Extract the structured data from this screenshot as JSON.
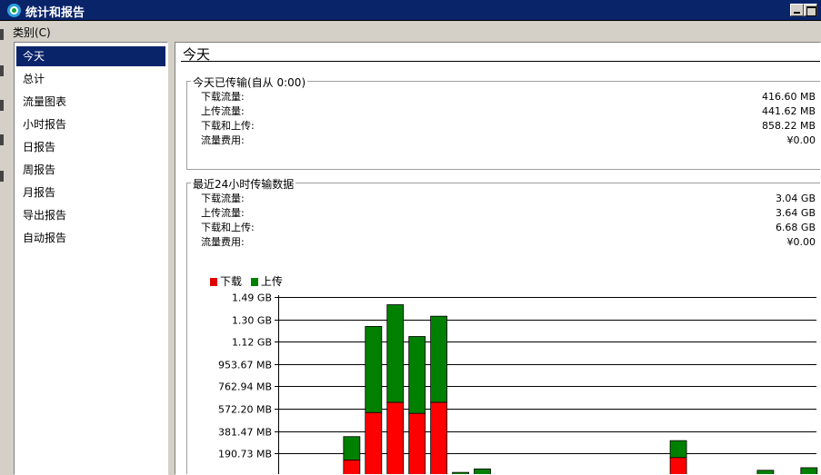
{
  "window": {
    "title": "统计和报告"
  },
  "menu": {
    "category_label": "类别(C)"
  },
  "sidebar": {
    "items": [
      {
        "label": "今天"
      },
      {
        "label": "总计"
      },
      {
        "label": "流量图表"
      },
      {
        "label": "小时报告"
      },
      {
        "label": "日报告"
      },
      {
        "label": "周报告"
      },
      {
        "label": "月报告"
      },
      {
        "label": "导出报告"
      },
      {
        "label": "自动报告"
      }
    ],
    "selected_index": 0
  },
  "main": {
    "title": "今天",
    "today_group": {
      "legend": "今天已传输(自从 0:00)",
      "rows": [
        {
          "label": "下载流量:",
          "value": "416.60 MB"
        },
        {
          "label": "上传流量:",
          "value": "441.62 MB"
        },
        {
          "label": "下载和上传:",
          "value": "858.22 MB"
        },
        {
          "label": "流量费用:",
          "value": "¥0.00"
        }
      ]
    },
    "last24_group": {
      "legend": "最近24小时传输数据",
      "rows": [
        {
          "label": "下载流量:",
          "value": "3.04 GB"
        },
        {
          "label": "上传流量:",
          "value": "3.64 GB"
        },
        {
          "label": "下载和上传:",
          "value": "6.68 GB"
        },
        {
          "label": "流量费用:",
          "value": "¥0.00"
        }
      ]
    }
  },
  "chart_data": {
    "type": "bar",
    "stacked": true,
    "y_unit": "MB",
    "ylim_visible": [
      0,
      1525.87
    ],
    "y_tick_values": [
      190.73,
      381.47,
      572.2,
      762.94,
      953.67,
      1144.4,
      1335.14,
      1525.87
    ],
    "y_tick_labels": [
      "190.73 MB",
      "381.47 MB",
      "572.20 MB",
      "762.94 MB",
      "953.67 MB",
      "1.12 GB",
      "1.30 GB",
      "1.49 GB"
    ],
    "grid": true,
    "legend_position": "top-left",
    "series": [
      {
        "name": "下载",
        "color": "#ff0000",
        "values": [
          0,
          0,
          0,
          135,
          540,
          627,
          533,
          627,
          5,
          10,
          0,
          0,
          0,
          0,
          0,
          0,
          0,
          0,
          156,
          0,
          0,
          0,
          10,
          0,
          10
        ]
      },
      {
        "name": "上传",
        "color": "#008000",
        "values": [
          8,
          6,
          6,
          200,
          735,
          833,
          656,
          735,
          25,
          50,
          0,
          0,
          0,
          0,
          0,
          0,
          0,
          0,
          145,
          0,
          0,
          0,
          38,
          10,
          60
        ]
      }
    ]
  }
}
